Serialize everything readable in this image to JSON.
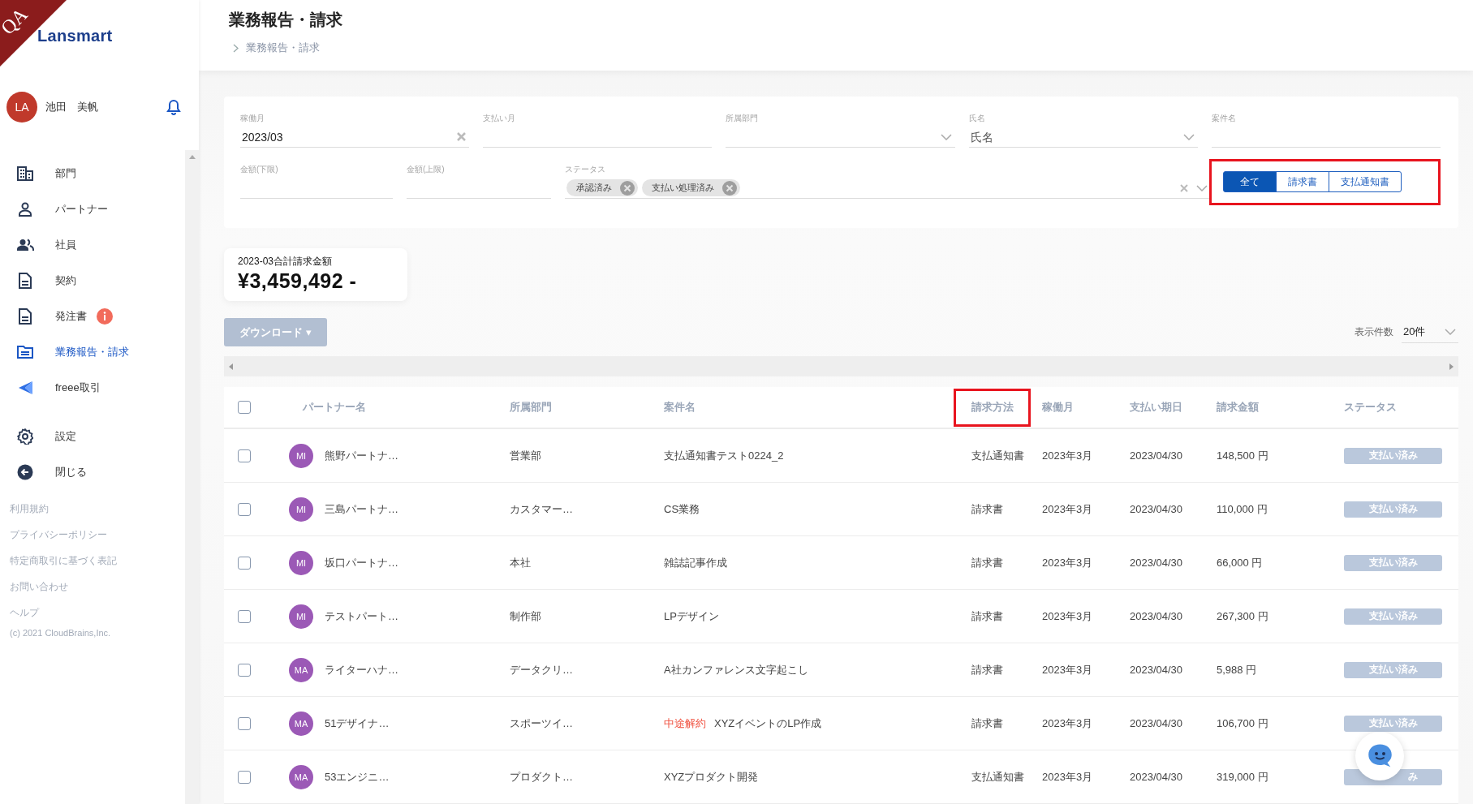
{
  "ribbon": {
    "text": "QA"
  },
  "sidebar": {
    "logo": "Lansmart",
    "user": {
      "initials": "LA",
      "name": "池田　美帆"
    },
    "nav": [
      {
        "label": "部門",
        "selected": false,
        "alert": false
      },
      {
        "label": "パートナー",
        "selected": false,
        "alert": false
      },
      {
        "label": "社員",
        "selected": false,
        "alert": false
      },
      {
        "label": "契約",
        "selected": false,
        "alert": false
      },
      {
        "label": "発注書",
        "selected": false,
        "alert": true
      },
      {
        "label": "業務報告・請求",
        "selected": true,
        "alert": false
      },
      {
        "label": "freee取引",
        "selected": false,
        "alert": false
      }
    ],
    "secondary": [
      {
        "label": "設定"
      },
      {
        "label": "閉じる"
      }
    ],
    "footer_links": [
      "利用規約",
      "プライバシーポリシー",
      "特定商取引に基づく表記",
      "お問い合わせ",
      "ヘルプ"
    ],
    "copyright": "(c) 2021 CloudBrains,Inc."
  },
  "header": {
    "title": "業務報告・請求",
    "breadcrumb": "業務報告・請求"
  },
  "filters": {
    "fields": [
      {
        "label": "稼働月",
        "value": "2023/03",
        "kind": "clearable"
      },
      {
        "label": "支払い月",
        "kind": "text"
      },
      {
        "label": "所属部門",
        "kind": "select"
      },
      {
        "label": "氏名",
        "placeholder": "氏名",
        "kind": "select"
      },
      {
        "label": "案件名",
        "kind": "text"
      },
      {
        "label": "金額(下限)",
        "kind": "text"
      },
      {
        "label": "金額(上限)",
        "kind": "text"
      },
      {
        "label": "ステータス",
        "kind": "chips",
        "chips": [
          "承認済み",
          "支払い処理済み"
        ]
      }
    ],
    "type_toggle": {
      "highlighted": true,
      "options": [
        {
          "label": "全て",
          "selected": true
        },
        {
          "label": "請求書",
          "selected": false
        },
        {
          "label": "支払通知書",
          "selected": false
        }
      ]
    }
  },
  "summary": {
    "label": "2023-03合計請求金額",
    "amount": "¥3,459,492 -"
  },
  "download_button": "ダウンロード ▾",
  "page_size": {
    "label": "表示件数",
    "value": "20件"
  },
  "table": {
    "all_checked": false,
    "columns": [
      {
        "label": "パートナー名",
        "highlighted": false
      },
      {
        "label": "所属部門",
        "highlighted": false
      },
      {
        "label": "案件名",
        "highlighted": false
      },
      {
        "label": "請求方法",
        "highlighted": true
      },
      {
        "label": "稼働月",
        "highlighted": false
      },
      {
        "label": "支払い期日",
        "highlighted": false
      },
      {
        "label": "請求金額",
        "highlighted": false
      },
      {
        "label": "ステータス",
        "highlighted": false
      }
    ],
    "rows": [
      {
        "checked": false,
        "initials": "MI",
        "partner": "熊野パートナ…",
        "department": "営業部",
        "project": "支払通知書テスト0224_2",
        "method": "支払通知書",
        "month": "2023年3月",
        "due": "2023/04/30",
        "amount": "148,500 円",
        "status": "支払い済み"
      },
      {
        "checked": false,
        "initials": "MI",
        "partner": "三島パートナ…",
        "department": "カスタマー…",
        "project": "CS業務",
        "method": "請求書",
        "month": "2023年3月",
        "due": "2023/04/30",
        "amount": "110,000 円",
        "status": "支払い済み"
      },
      {
        "checked": false,
        "initials": "MI",
        "partner": "坂口パートナ…",
        "department": "本社",
        "project": "雑誌記事作成",
        "method": "請求書",
        "month": "2023年3月",
        "due": "2023/04/30",
        "amount": "66,000 円",
        "status": "支払い済み"
      },
      {
        "checked": false,
        "initials": "MI",
        "partner": "テストパート…",
        "department": "制作部",
        "project": "LPデザイン",
        "method": "請求書",
        "month": "2023年3月",
        "due": "2023/04/30",
        "amount": "267,300 円",
        "status": "支払い済み"
      },
      {
        "checked": false,
        "initials": "MA",
        "partner": "ライターハナ…",
        "department": "データクリ…",
        "project": "A社カンファレンス文字起こし",
        "method": "請求書",
        "month": "2023年3月",
        "due": "2023/04/30",
        "amount": "5,988 円",
        "status": "支払い済み"
      },
      {
        "checked": false,
        "initials": "MA",
        "partner": "51デザイナ…",
        "department": "スポーツイ…",
        "tag": "中途解約",
        "project": "XYZイベントのLP作成",
        "method": "請求書",
        "month": "2023年3月",
        "due": "2023/04/30",
        "amount": "106,700 円",
        "status": "支払い済み"
      },
      {
        "checked": false,
        "initials": "MA",
        "partner": "53エンジニ…",
        "department": "プロダクト…",
        "project": "XYZプロダクト開発",
        "method": "支払通知書",
        "month": "2023年3月",
        "due": "2023/04/30",
        "amount": "319,000 円",
        "status": "み"
      }
    ]
  }
}
